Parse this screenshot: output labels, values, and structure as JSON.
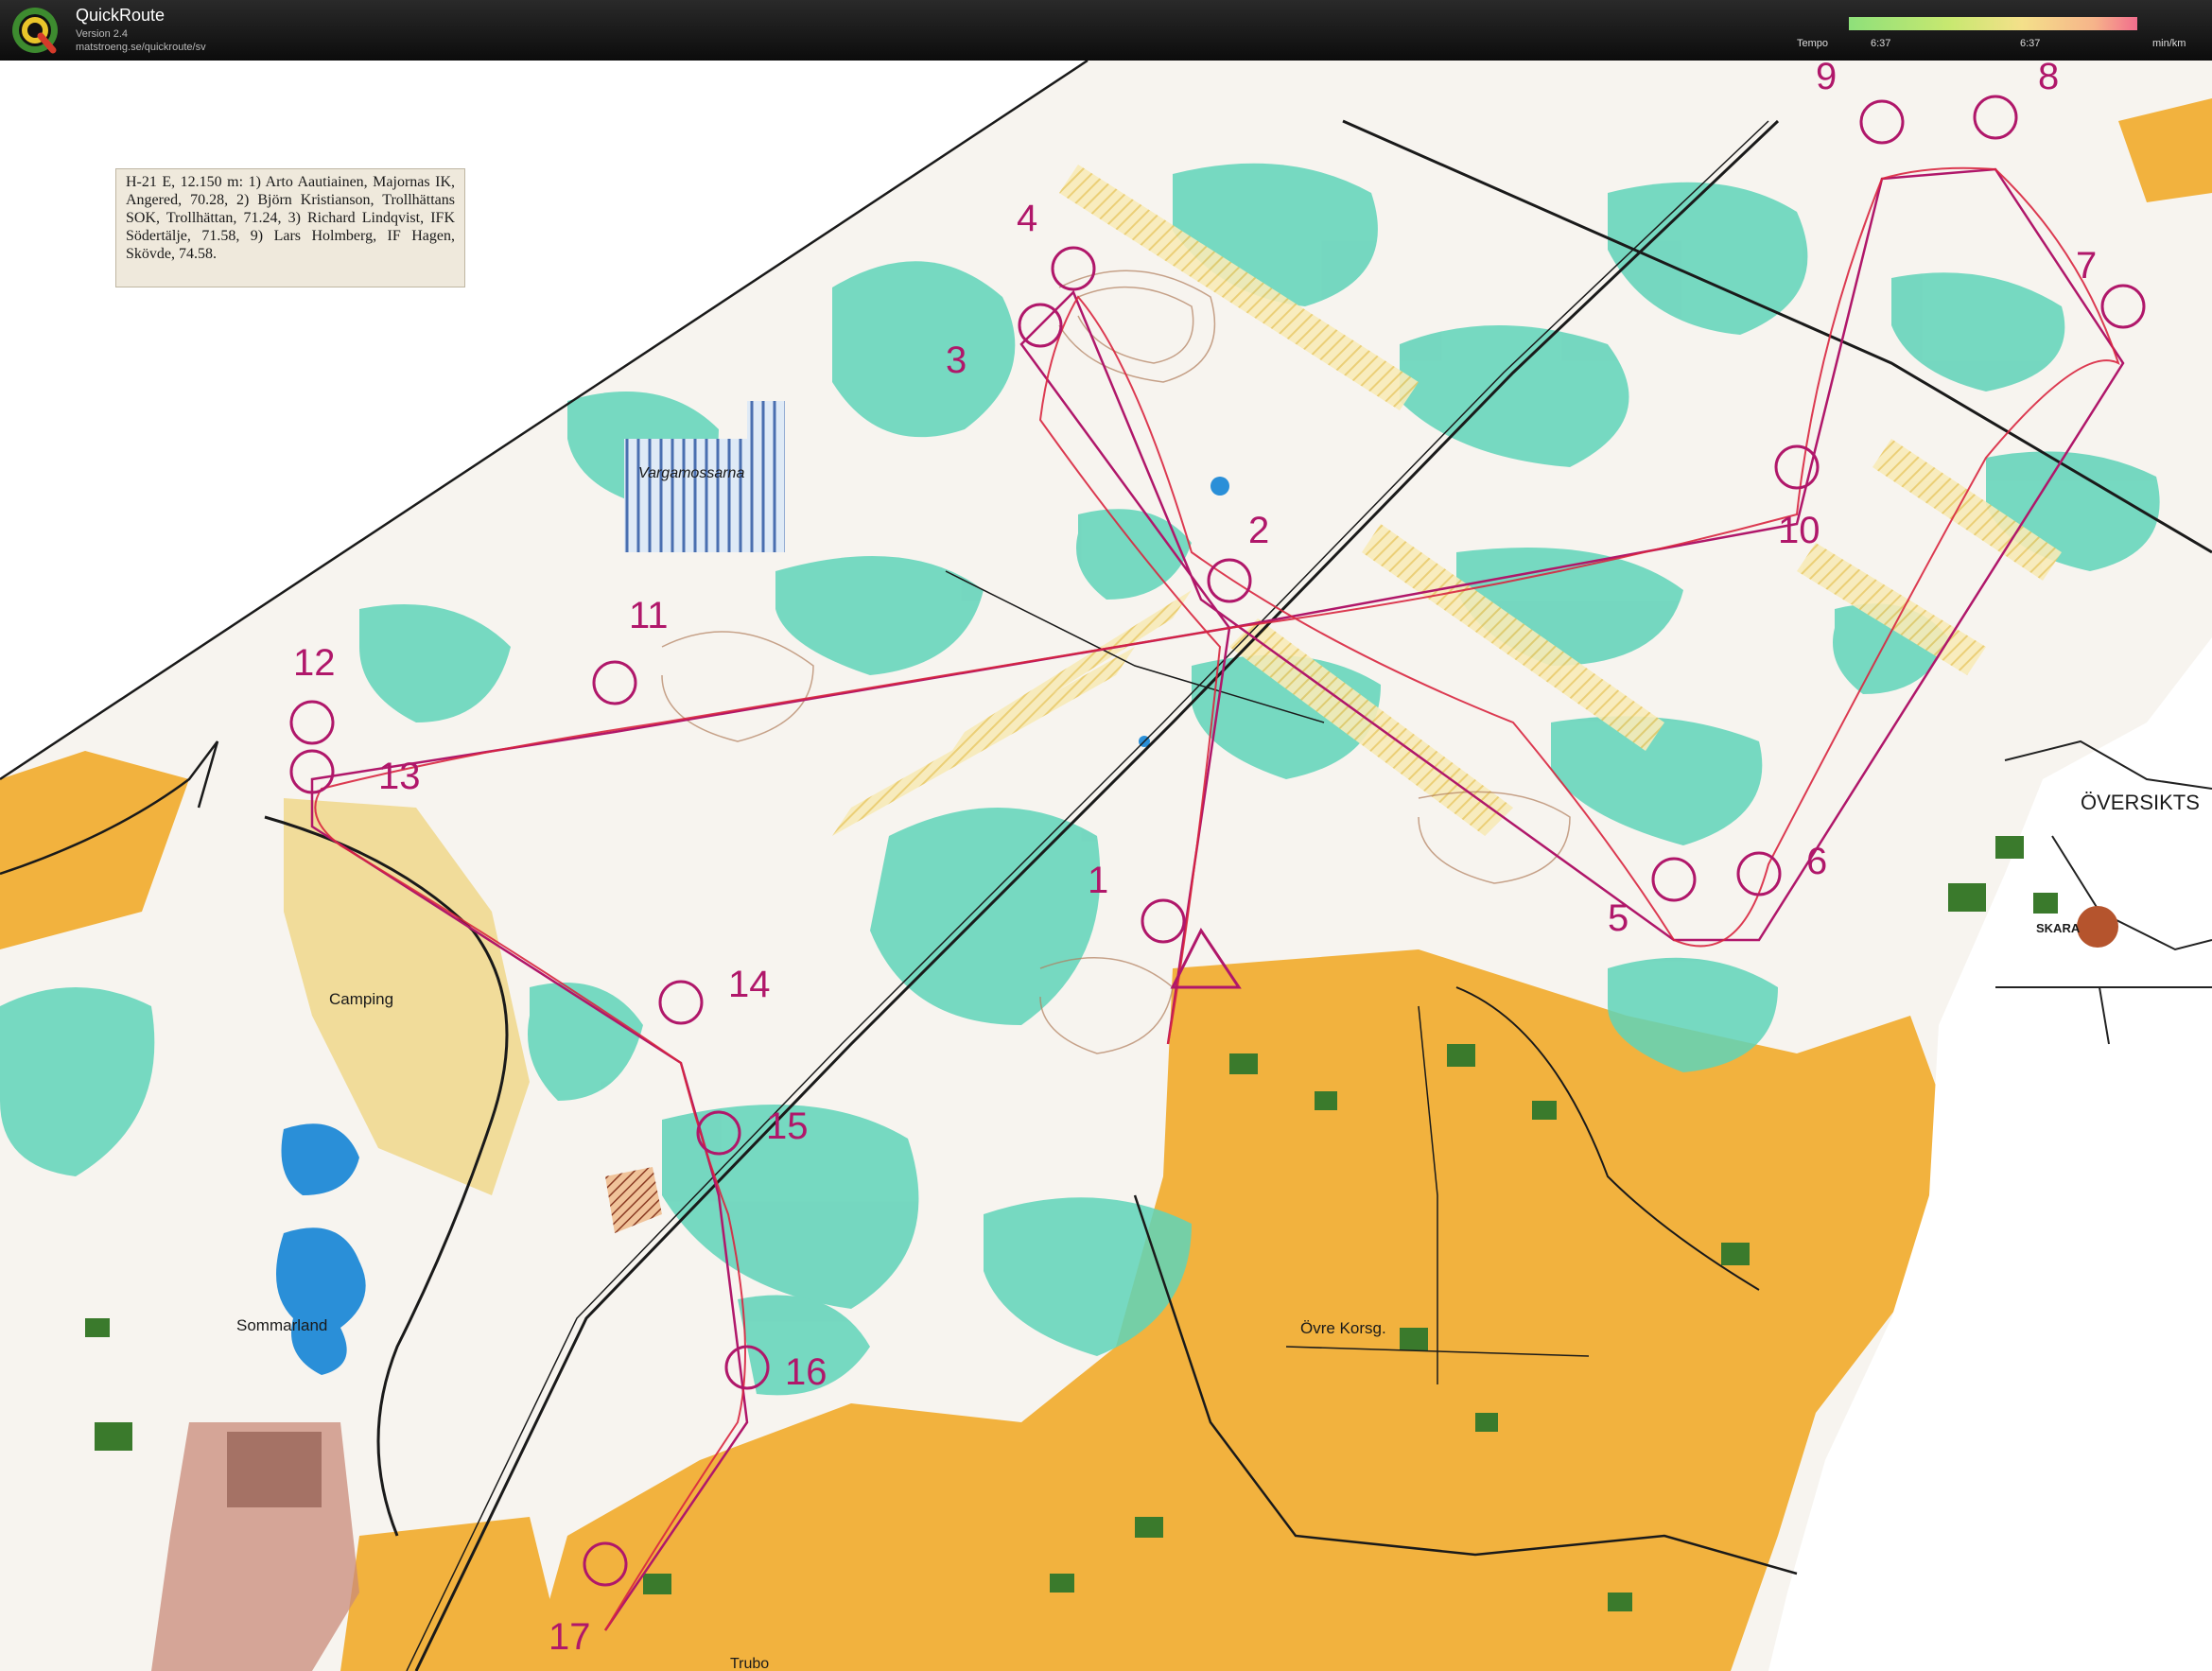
{
  "app": {
    "title": "QuickRoute",
    "version": "Version 2.4",
    "url": "matstroeng.se/quickroute/sv"
  },
  "pace_scale": {
    "label": "Tempo",
    "left_value": "6:37",
    "right_value": "6:37",
    "unit": "min/km",
    "gradient_colors": [
      "#8ee07a",
      "#c8e870",
      "#f4e08a",
      "#f6b48a",
      "#f26d8d"
    ]
  },
  "info_text": "H-21 E, 12.150 m: 1) Arto Aautiainen, Majornas IK, Angered, 70.28, 2) Björn Kristianson, Trollhättans SOK, Trollhättan, 71.24, 3) Richard Lindqvist, IFK Södertälje, 71.58, 9) Lars Holmberg, IF Hagen, Skövde, 74.58.",
  "place_names": {
    "vargamossarna": "Vargamossarna",
    "camping": "Camping",
    "sommarland": "Sommarland",
    "ovre_korsg": "Övre Korsg.",
    "oversikts": "ÖVERSIKTS",
    "skara": "SKARA",
    "trubo": "Trubo"
  },
  "controls": [
    {
      "number": "1"
    },
    {
      "number": "2"
    },
    {
      "number": "3"
    },
    {
      "number": "4"
    },
    {
      "number": "5"
    },
    {
      "number": "6"
    },
    {
      "number": "7"
    },
    {
      "number": "8"
    },
    {
      "number": "9"
    },
    {
      "number": "10"
    },
    {
      "number": "11"
    },
    {
      "number": "12"
    },
    {
      "number": "13"
    },
    {
      "number": "14"
    },
    {
      "number": "15"
    },
    {
      "number": "16"
    },
    {
      "number": "17"
    }
  ],
  "colors": {
    "paper": "#f7f4ef",
    "forest_green": "#5fd3b8",
    "open_yellow": "#f2b23e",
    "course_purple": "#b0176a",
    "route_red": "#d8263f",
    "water_blue": "#2a8fd8",
    "contour_brown": "#b07d5c",
    "settlement_green": "#3a7a2c"
  }
}
